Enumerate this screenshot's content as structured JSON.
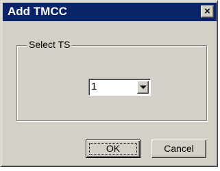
{
  "window": {
    "title": "Add TMCC",
    "close_label": "×",
    "titlebar_color": "#0a246a",
    "face_color": "#d4d0c8"
  },
  "group": {
    "legend": "Select TS"
  },
  "combo": {
    "value": "1",
    "arrow_icon": "chevron-down-icon"
  },
  "buttons": {
    "ok": "OK",
    "cancel": "Cancel"
  }
}
